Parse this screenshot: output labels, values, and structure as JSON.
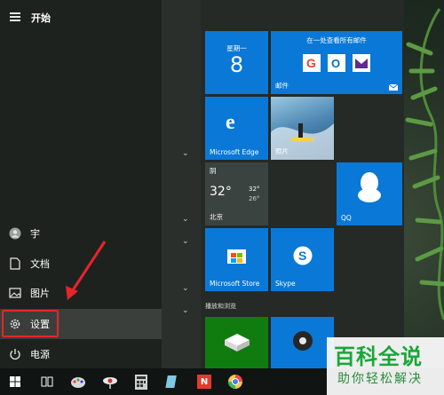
{
  "start_menu": {
    "title": "开始",
    "nav_items": [
      {
        "label": "宇",
        "icon": "user-avatar-icon"
      },
      {
        "label": "文档",
        "icon": "document-icon"
      },
      {
        "label": "图片",
        "icon": "picture-icon"
      },
      {
        "label": "设置",
        "icon": "gear-icon"
      },
      {
        "label": "电源",
        "icon": "power-icon"
      }
    ],
    "highlighted": "设置"
  },
  "tiles": {
    "calendar": {
      "day": "星期一",
      "date": "8"
    },
    "mail": {
      "top_text": "在一处查看所有邮件",
      "name": "邮件"
    },
    "edge": {
      "name": "Microsoft Edge"
    },
    "photos": {
      "name": "照片"
    },
    "weather": {
      "condition": "阴",
      "temp": "32°",
      "high": "32°",
      "low": "26°",
      "city": "北京"
    },
    "qq": {
      "name": "QQ"
    },
    "store": {
      "name": "Microsoft Store"
    },
    "skype": {
      "name": "Skype"
    }
  },
  "section_title": "播放和浏览",
  "taskbar": {
    "icons": [
      "start-icon",
      "task-view-icon",
      "paint-icon",
      "network-icon",
      "calculator-icon",
      "notepad-icon",
      "netease-icon",
      "chrome-like-icon"
    ],
    "app_label": "N"
  },
  "watermark": {
    "title": "百科全说",
    "subtitle": "助你轻松解决"
  },
  "colors": {
    "tile_blue": "#0a78d7",
    "tile_green": "#107c10",
    "highlight": "#e8242b",
    "watermark_green": "#1aa639"
  }
}
